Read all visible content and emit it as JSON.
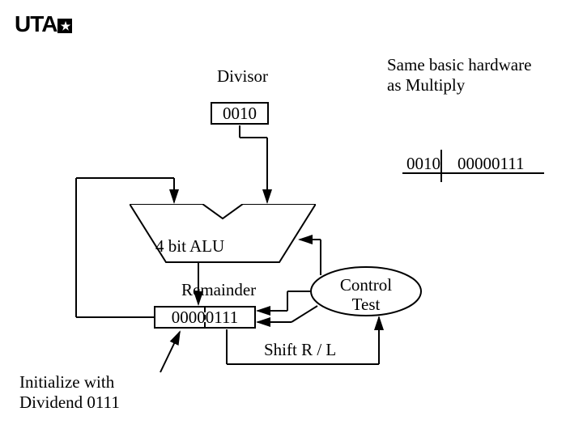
{
  "logo": {
    "text": "UTA",
    "star": "★"
  },
  "labels": {
    "divisor": "Divisor",
    "note_line1": "Same basic hardware",
    "note_line2": "as Multiply",
    "alu": "4 bit ALU",
    "remainder": "Remainder",
    "control_line1": "Control",
    "control_line2": "Test",
    "shift": "Shift R / L",
    "init_line1": "Initialize with",
    "init_line2": "Dividend 0111"
  },
  "values": {
    "divisor_reg": "0010",
    "long_div_divisor": "0010",
    "long_div_dividend": "00000111",
    "remainder_reg": "00000111"
  }
}
